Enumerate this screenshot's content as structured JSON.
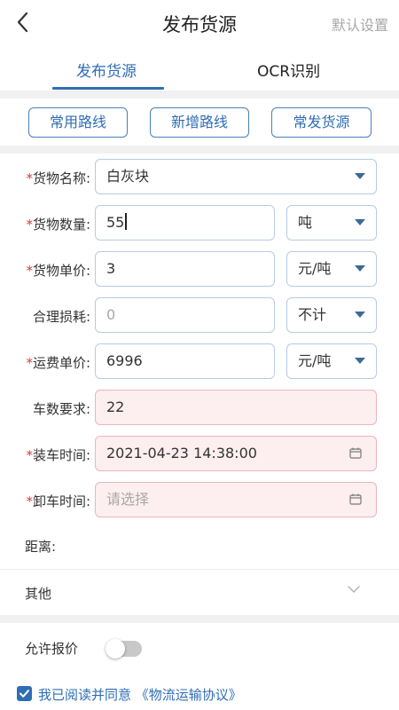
{
  "header": {
    "title": "发布货源",
    "right_action": "默认设置"
  },
  "tabs": [
    {
      "label": "发布货源",
      "active": true
    },
    {
      "label": "OCR识别",
      "active": false
    }
  ],
  "quick_buttons": [
    "常用路线",
    "新增路线",
    "常发货源"
  ],
  "form": {
    "cargo_name": {
      "label": "货物名称:",
      "required": true,
      "value": "白灰块"
    },
    "cargo_qty": {
      "label": "货物数量:",
      "required": true,
      "value": "55",
      "unit": "吨"
    },
    "unit_price": {
      "label": "货物单价:",
      "required": true,
      "value": "3",
      "unit": "元/吨"
    },
    "loss": {
      "label": "合理损耗:",
      "required": false,
      "placeholder": "0",
      "unit": "不计"
    },
    "freight_price": {
      "label": "运费单价:",
      "required": true,
      "value": "6996",
      "unit": "元/吨"
    },
    "truck_count": {
      "label": "车数要求:",
      "required": false,
      "value": "22"
    },
    "load_time": {
      "label": "装车时间:",
      "required": true,
      "value": "2021-04-23 14:38:00"
    },
    "unload_time": {
      "label": "卸车时间:",
      "required": true,
      "placeholder": "请选择"
    },
    "distance": {
      "label": "距离:"
    }
  },
  "other": {
    "label": "其他"
  },
  "allow_quote": {
    "label": "允许报价",
    "enabled": false
  },
  "agreement": {
    "checked": true,
    "prefix": "我已阅读并同意",
    "link": "《物流运输协议》"
  },
  "colors": {
    "accent": "#2f6db5",
    "required": "#d73a3a",
    "field_border": "#b7cbe2",
    "highlight_bg": "#fdeef0"
  },
  "icons": [
    "back-arrow-icon",
    "dropdown-arrow-icon",
    "calendar-icon",
    "chevron-down-icon",
    "checkmark-icon"
  ]
}
